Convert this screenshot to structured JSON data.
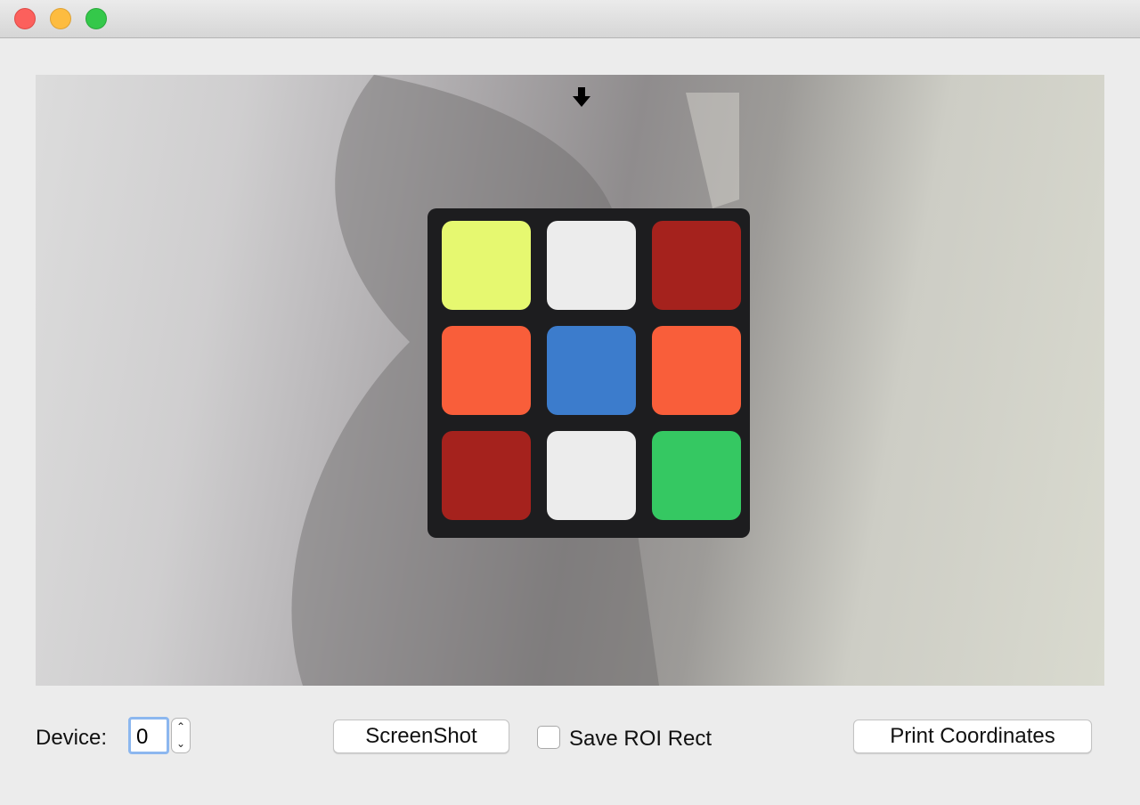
{
  "window": {
    "traffic_lights": {
      "close": "#fc605c",
      "minimize": "#fdbc40",
      "maximize": "#34c84a"
    }
  },
  "camera": {
    "cursor_icon": "arrow-down-icon",
    "cube_stickers": [
      [
        "yellow",
        "white",
        "red"
      ],
      [
        "orange",
        "blue",
        "orange"
      ],
      [
        "red",
        "white",
        "green"
      ]
    ],
    "sticker_colors": {
      "yellow": "#e6f870",
      "white": "#ececec",
      "red": "#a5221d",
      "orange": "#f95e3a",
      "blue": "#3c7ccc",
      "green": "#35c862"
    }
  },
  "controls": {
    "device_label": "Device:",
    "device_value": "0",
    "screenshot_label": "ScreenShot",
    "save_roi_label": "Save ROI Rect",
    "save_roi_checked": false,
    "print_coordinates_label": "Print Coordinates"
  }
}
